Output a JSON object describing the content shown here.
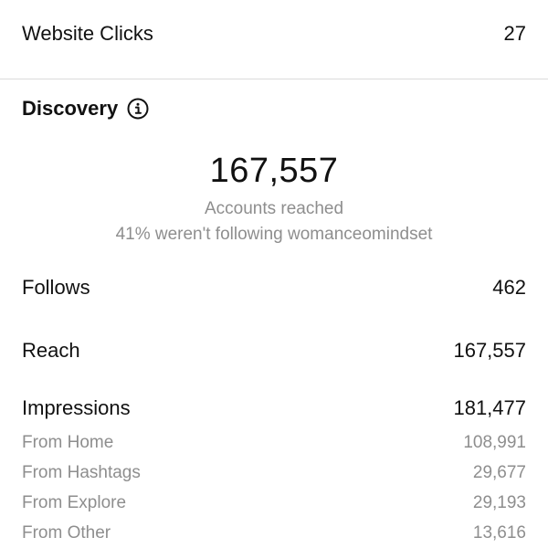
{
  "website_clicks": {
    "label": "Website Clicks",
    "value": "27"
  },
  "discovery": {
    "title": "Discovery",
    "info_icon": "info-icon",
    "accounts_reached_value": "167,557",
    "accounts_reached_label": "Accounts reached",
    "not_following_note": "41% weren't following womanceomindset"
  },
  "metrics": {
    "follows": {
      "label": "Follows",
      "value": "462"
    },
    "reach": {
      "label": "Reach",
      "value": "167,557"
    },
    "impressions": {
      "label": "Impressions",
      "value": "181,477"
    }
  },
  "impression_sources": [
    {
      "label": "From Home",
      "value": "108,991"
    },
    {
      "label": "From Hashtags",
      "value": "29,677"
    },
    {
      "label": "From Explore",
      "value": "29,193"
    },
    {
      "label": "From Other",
      "value": "13,616"
    }
  ],
  "colors": {
    "primary_text": "#111111",
    "secondary_text": "#8e8e8e",
    "divider": "#dbdbdb",
    "background": "#ffffff"
  }
}
